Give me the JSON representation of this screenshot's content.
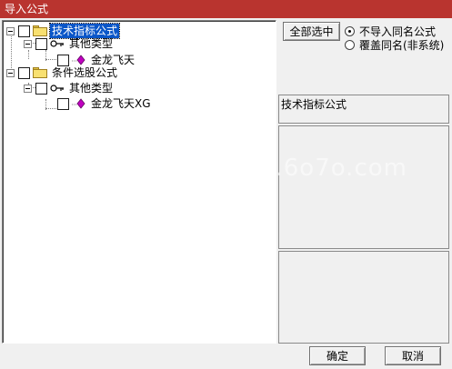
{
  "window": {
    "title": "导入公式"
  },
  "tree": {
    "nodes": [
      {
        "label": "技术指标公式",
        "type": "folder",
        "selected": true,
        "children": [
          {
            "label": "其他类型",
            "type": "category",
            "children": [
              {
                "label": "金龙飞天",
                "type": "formula"
              }
            ]
          }
        ]
      },
      {
        "label": "条件选股公式",
        "type": "folder",
        "selected": false,
        "children": [
          {
            "label": "其他类型",
            "type": "category",
            "children": [
              {
                "label": "金龙飞天XG",
                "type": "formula"
              }
            ]
          }
        ]
      }
    ]
  },
  "options": {
    "select_all_label": "全部选中",
    "radio_skip_label": "不导入同名公式",
    "radio_overwrite_label": "覆盖同名(非系统)",
    "selected_option": "skip"
  },
  "detail": {
    "type_title": "技术指标公式"
  },
  "watermark": "u.6o7o.com",
  "buttons": {
    "ok_label": "确定",
    "cancel_label": "取消"
  },
  "colors": {
    "titlebar": "#b9342f",
    "selection": "#0a56c8"
  },
  "icons": [
    "folder-icon",
    "key-icon",
    "formula-icon"
  ]
}
